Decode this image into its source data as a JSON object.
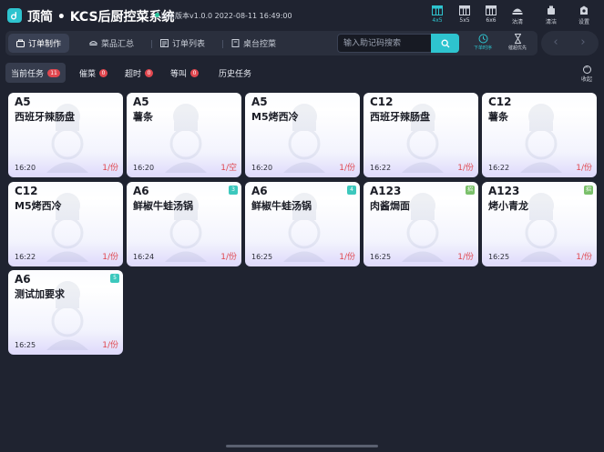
{
  "app": {
    "title": "顶简 • KCS后厨控菜系统",
    "version": "当前版本v1.0.0  2022-08-11 16:49:00"
  },
  "header_buttons": [
    {
      "label": "4x5",
      "icon": "grid-4x5-icon",
      "active": true
    },
    {
      "label": "5x5",
      "icon": "grid-5x5-icon",
      "active": false
    },
    {
      "label": "6x6",
      "icon": "grid-6x6-icon",
      "active": false
    },
    {
      "label": "沽清",
      "icon": "sold-out-icon",
      "active": false
    },
    {
      "label": "清洁",
      "icon": "clean-icon",
      "active": false
    },
    {
      "label": "设置",
      "icon": "gear-icon",
      "active": false
    }
  ],
  "tabs": [
    {
      "label": "订单制作",
      "icon": "order-make-icon",
      "active": true
    },
    {
      "label": "菜品汇总",
      "icon": "dish-summary-icon",
      "active": false
    },
    {
      "label": "订单列表",
      "icon": "order-list-icon",
      "active": false
    },
    {
      "label": "桌台控菜",
      "icon": "table-control-icon",
      "active": false
    }
  ],
  "search": {
    "placeholder": "输入助记码搜索"
  },
  "toolbar": {
    "order_time_label": "下单时序",
    "timeout_priority_label": "催超优先"
  },
  "filters": [
    {
      "label": "当前任务",
      "count": "11",
      "active": true
    },
    {
      "label": "催菜",
      "count": "0",
      "active": false
    },
    {
      "label": "超时",
      "count": "0",
      "active": false
    },
    {
      "label": "等叫",
      "count": "0",
      "active": false
    },
    {
      "label": "历史任务",
      "count": "",
      "active": false
    }
  ],
  "collapse_label": "收起",
  "colors": {
    "accent": "#2ec4cf",
    "background": "#1f2330",
    "badge_red": "#e0474f",
    "tag_teal": "#3cc8bd",
    "tag_green": "#7ac06a"
  },
  "cards": [
    {
      "table": "A5",
      "dish": "西班牙辣肠盘",
      "time": "16:20",
      "qty": "1/份",
      "tag": ""
    },
    {
      "table": "A5",
      "dish": "薯条",
      "time": "16:20",
      "qty": "1/空",
      "tag": ""
    },
    {
      "table": "A5",
      "dish": "M5烤西冷",
      "time": "16:20",
      "qty": "1/份",
      "tag": ""
    },
    {
      "table": "C12",
      "dish": "西班牙辣肠盘",
      "time": "16:22",
      "qty": "1/份",
      "tag": ""
    },
    {
      "table": "C12",
      "dish": "薯条",
      "time": "16:22",
      "qty": "1/份",
      "tag": ""
    },
    {
      "table": "C12",
      "dish": "M5烤西冷",
      "time": "16:22",
      "qty": "1/份",
      "tag": ""
    },
    {
      "table": "A6",
      "dish": "鲜椒牛蛙汤锅",
      "time": "16:24",
      "qty": "1/份",
      "tag": "3",
      "tag_color": "#3cc8bd"
    },
    {
      "table": "A6",
      "dish": "鲜椒牛蛙汤锅",
      "time": "16:25",
      "qty": "1/份",
      "tag": "4",
      "tag_color": "#3cc8bd"
    },
    {
      "table": "A123",
      "dish": "肉酱焗面",
      "time": "16:25",
      "qty": "1/份",
      "tag": "招",
      "tag_color": "#7ac06a"
    },
    {
      "table": "A123",
      "dish": "烤小青龙",
      "time": "16:25",
      "qty": "1/份",
      "tag": "招",
      "tag_color": "#7ac06a"
    },
    {
      "table": "A6",
      "dish": "测试加要求",
      "time": "16:25",
      "qty": "1/份",
      "tag": "5",
      "tag_color": "#3cc8bd"
    }
  ]
}
